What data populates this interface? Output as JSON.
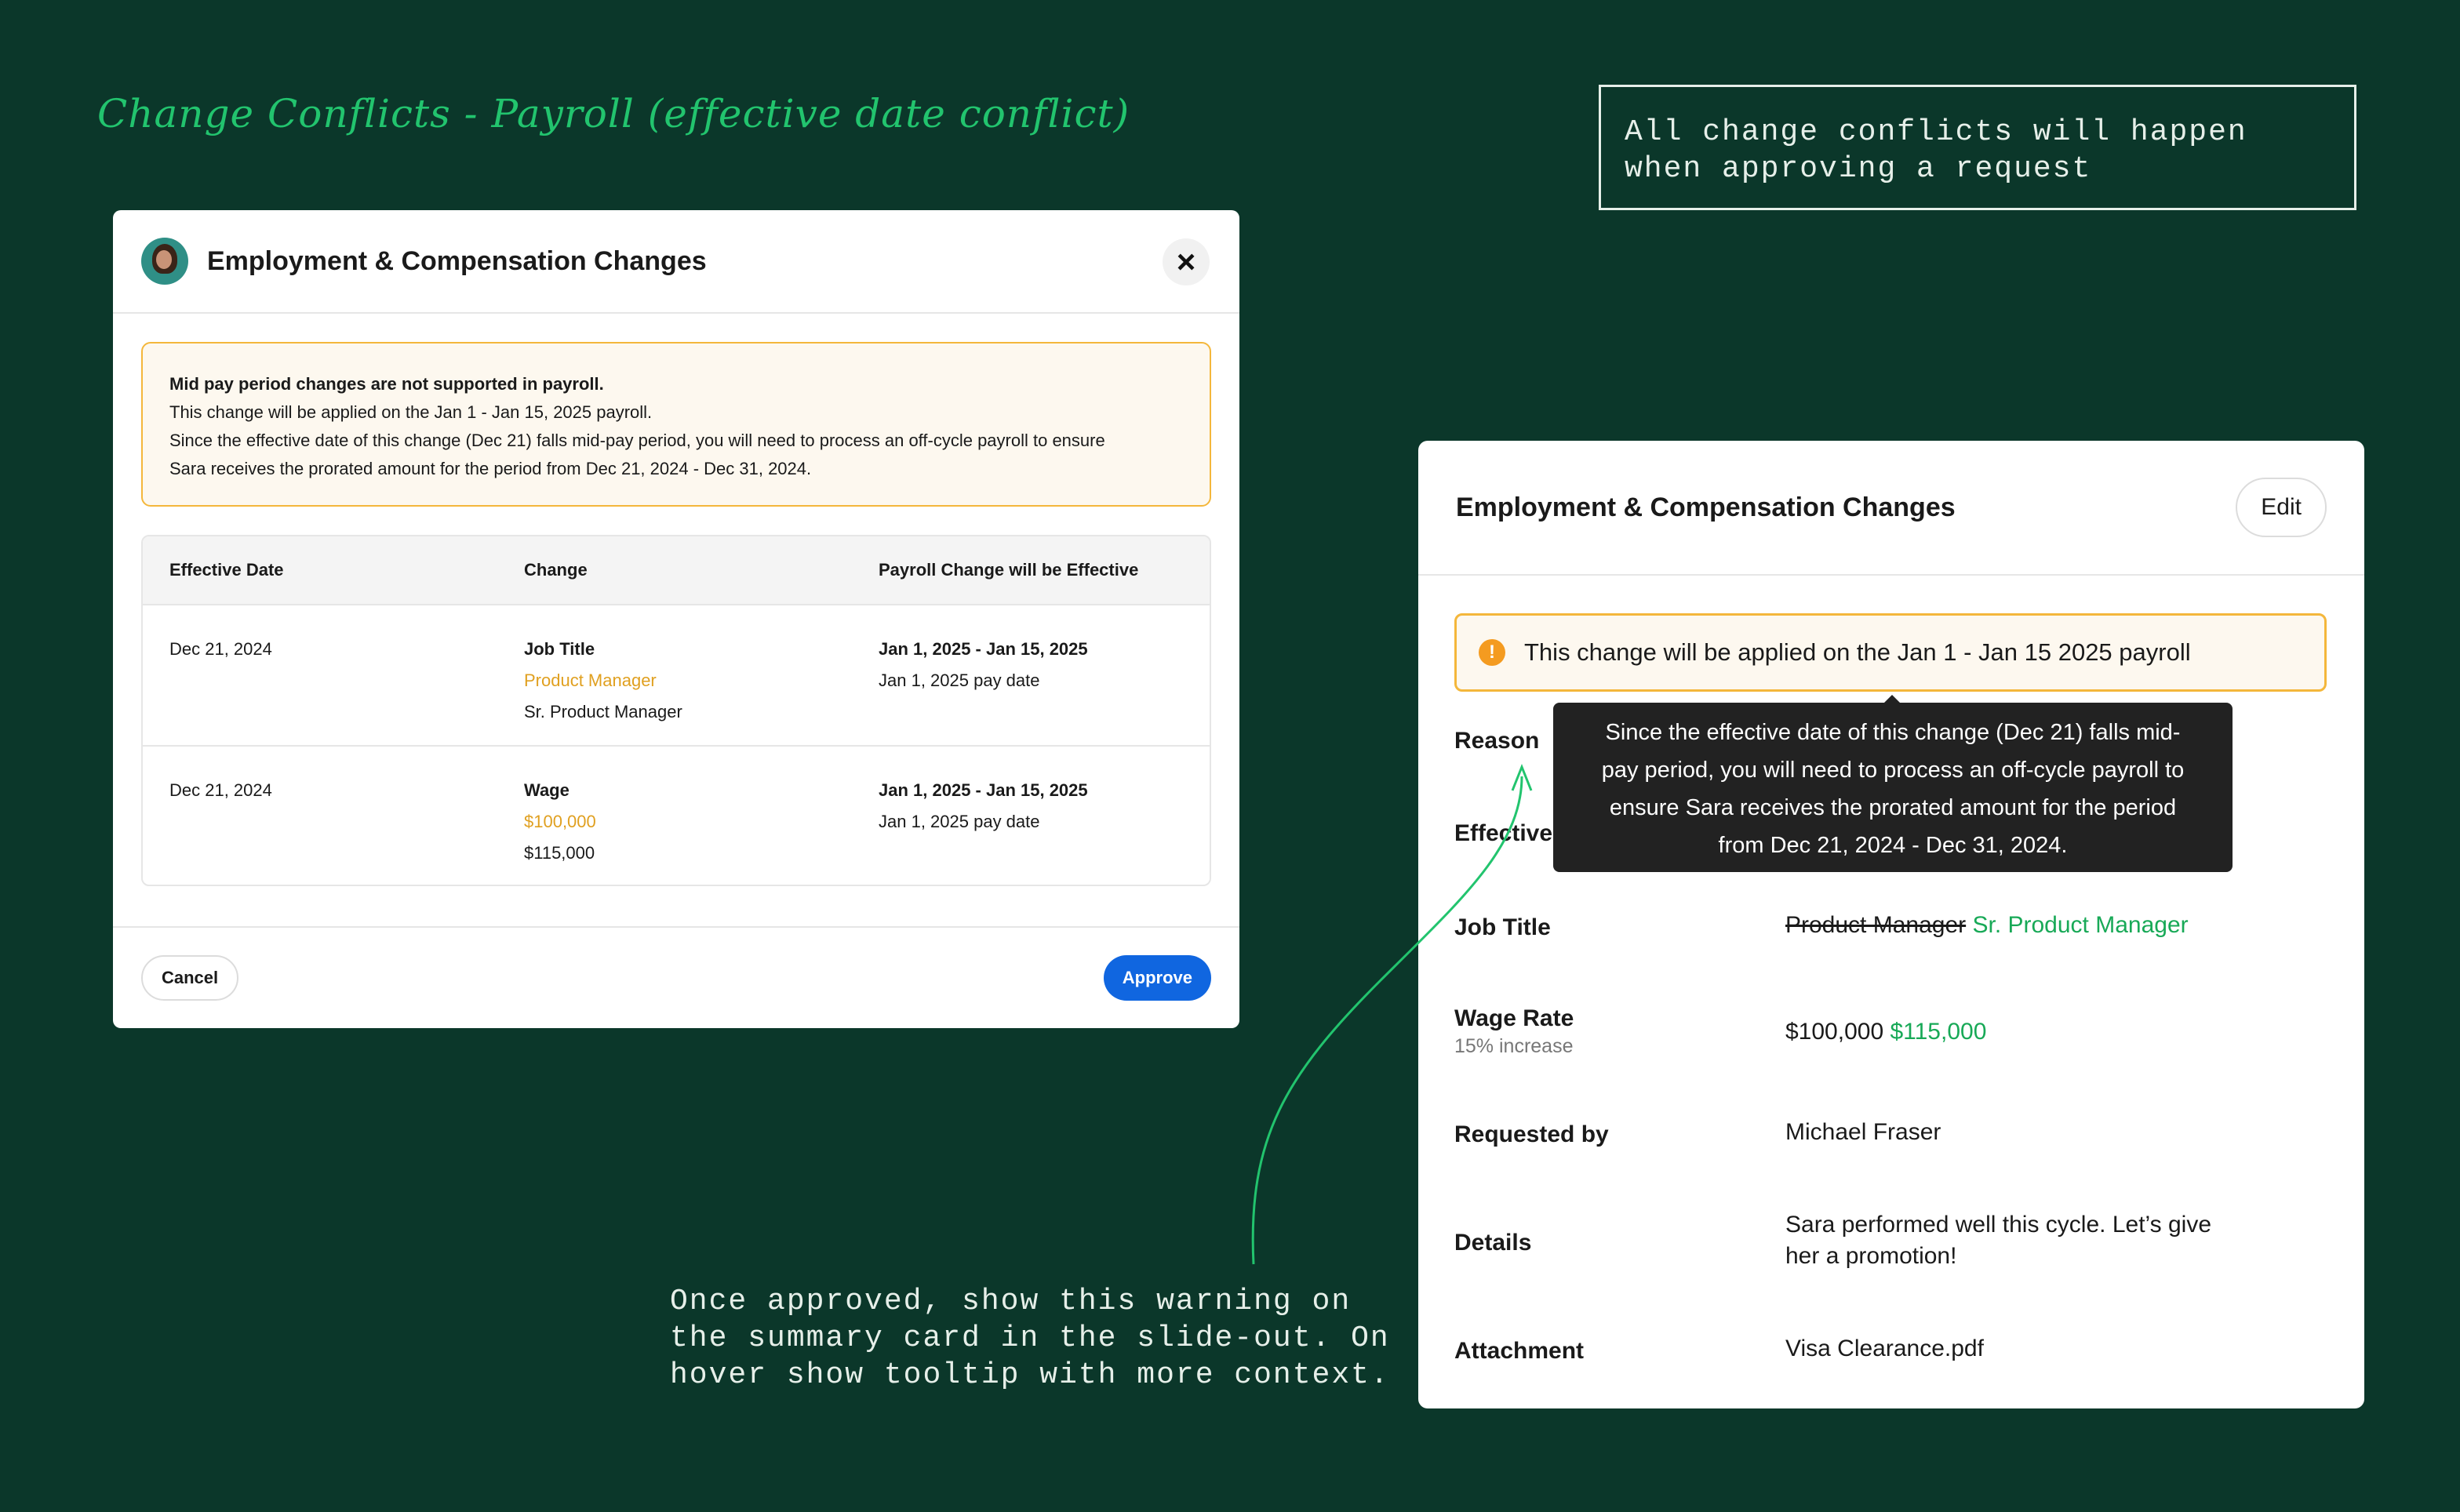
{
  "page": {
    "heading": "Change Conflicts - Payroll (effective date conflict)",
    "note_top": "All change conflicts will happen when approving a request",
    "note_bottom": [
      "Once approved, show this warning on",
      "the summary card in the slide-out. On",
      "hover show tooltip with more context."
    ]
  },
  "modal": {
    "title": "Employment & Compensation Changes",
    "close_icon": "close-icon",
    "alert": {
      "title": "Mid pay period changes are not supported in payroll.",
      "lines": [
        "This change will be applied on the Jan 1 - Jan 15, 2025 payroll.",
        "Since the effective date of this change (Dec 21) falls mid-pay period, you will need to process an off-cycle payroll to ensure",
        "Sara receives the prorated amount for the period from Dec 21, 2024 - Dec 31, 2024."
      ]
    },
    "table": {
      "headers": [
        "Effective Date",
        "Change",
        "Payroll Change will be Effective"
      ],
      "rows": [
        {
          "date": "Dec 21, 2024",
          "change_label": "Job Title",
          "old_value": "Product Manager",
          "new_value": "Sr. Product Manager",
          "period": "Jan 1, 2025 - Jan 15, 2025",
          "pay_date": "Jan 1, 2025 pay date"
        },
        {
          "date": "Dec 21, 2024",
          "change_label": "Wage",
          "old_value": "$100,000",
          "new_value": "$115,000",
          "period": "Jan 1, 2025 - Jan 15, 2025",
          "pay_date": "Jan 1, 2025 pay date"
        }
      ]
    },
    "cancel_label": "Cancel",
    "approve_label": "Approve"
  },
  "card": {
    "title": "Employment & Compensation Changes",
    "edit_label": "Edit",
    "alert_text": "This change will be applied on the Jan 1 - Jan 15 2025 payroll",
    "warn_icon": "warning-icon",
    "reason_label": "Reason",
    "effective_label": "Effective",
    "job_title_label": "Job Title",
    "job_title_old": "Product Manager",
    "job_title_new": "Sr. Product Manager",
    "wage_label": "Wage Rate",
    "wage_sub": "15% increase",
    "wage_old": "$100,000",
    "wage_new": "$115,000",
    "requested_label": "Requested by",
    "requested_value": "Michael Fraser",
    "details_label": "Details",
    "details_lines": [
      "Sara performed well this cycle. Let’s give",
      "her a promotion!"
    ],
    "attachment_label": "Attachment",
    "attachment_value": "Visa Clearance.pdf"
  },
  "tooltip": {
    "lines": [
      "Since the effective date of this change (Dec 21) falls mid-",
      "pay period, you will need to process an off-cycle payroll to",
      "ensure Sara receives the prorated amount for the period",
      "from Dec 21, 2024 - Dec 31, 2024."
    ]
  },
  "colors": {
    "background": "#0b372a",
    "heading": "#22c46e",
    "warning": "#f4b73b",
    "primary": "#1066e0",
    "positive": "#18a957"
  }
}
